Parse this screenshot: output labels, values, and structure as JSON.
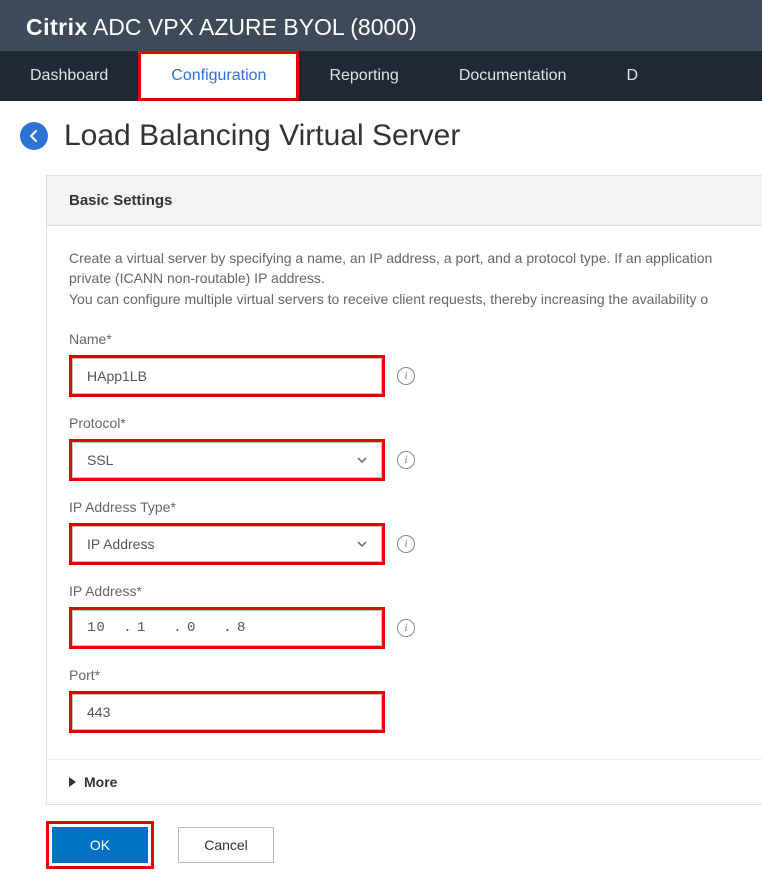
{
  "header": {
    "brand": "Citrix",
    "product": "ADC VPX AZURE BYOL (8000)"
  },
  "nav": {
    "items": [
      "Dashboard",
      "Configuration",
      "Reporting",
      "Documentation",
      "D"
    ],
    "active_index": 1
  },
  "page": {
    "title": "Load Balancing Virtual Server"
  },
  "panel": {
    "heading": "Basic Settings",
    "desc_line1": "Create a virtual server by specifying a name, an IP address, a port, and a protocol type. If an application",
    "desc_line2": "private (ICANN non-routable) IP address.",
    "desc_line3": "You can configure multiple virtual servers to receive client requests, thereby increasing the availability o"
  },
  "fields": {
    "name": {
      "label": "Name*",
      "value": "HApp1LB"
    },
    "protocol": {
      "label": "Protocol*",
      "value": "SSL"
    },
    "ip_type": {
      "label": "IP Address Type*",
      "value": "IP Address"
    },
    "ip_address": {
      "label": "IP Address*",
      "oct1": "10",
      "oct2": "1",
      "oct3": "0",
      "oct4": "8"
    },
    "port": {
      "label": "Port*",
      "value": "443"
    },
    "more": "More"
  },
  "buttons": {
    "ok": "OK",
    "cancel": "Cancel"
  }
}
